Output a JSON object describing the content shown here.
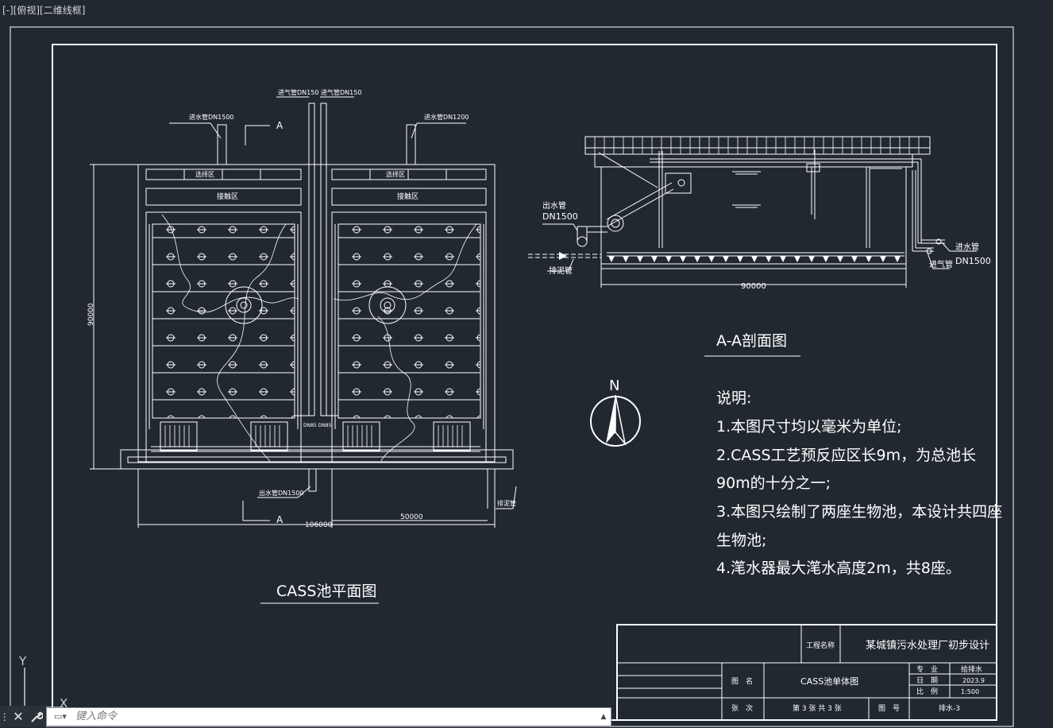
{
  "viewport": {
    "label": "[-][俯视][二维线框]"
  },
  "plan_view": {
    "title": "CASS池平面图",
    "section_marker": "A",
    "pipes": {
      "inlet_left": "进水管DN1500",
      "inlet_right": "进水管DN1200",
      "air_left": "进气管DN150",
      "air_right": "进气管DN150",
      "drain": "排泥管",
      "outlet": "出水管DN1500",
      "small_pipes": "DN85 DN85"
    },
    "zones": {
      "pre_reaction": "选择区",
      "contact": "接触区"
    },
    "dims": {
      "height": "90000",
      "total_width": "106000",
      "half_width": "50000"
    }
  },
  "section_view": {
    "title": "A-A剖面图",
    "outlet_label": "出水管",
    "outlet_dn": "DN1500",
    "drain_label": "排泥管",
    "inlet_label": "进水管",
    "inlet_dn": "DN1500",
    "air_label": "进气管",
    "length": "90000"
  },
  "north": {
    "label": "N"
  },
  "notes": {
    "heading": "说明:",
    "items": [
      "1.本图尺寸均以毫米为单位;",
      "2.CASS工艺预反应区长9m，为总池长",
      "90m的十分之一;",
      "3.本图只绘制了两座生物池，本设计共四座",
      "生物池;",
      "4.滗水器最大滗水高度2m，共8座。"
    ]
  },
  "title_block": {
    "project_label": "工程名称",
    "project_name": "某城镇污水处理厂初步设计",
    "drawing_label": "图　名",
    "drawing_name": "CASS池单体图",
    "specialty_label": "专　业",
    "specialty_value": "给排水",
    "date_label": "日　期",
    "date_value": "2023.9",
    "scale_label": "比　例",
    "scale_value": "1:500",
    "sheet_label": "张　次",
    "sheet_value": "第 3 张  共 3 张",
    "number_label": "图　号",
    "number_value": "排水-3"
  },
  "ucs": {
    "y": "Y",
    "x": "X"
  },
  "command_line": {
    "placeholder": "键入命令"
  },
  "colors": {
    "background": "#212830",
    "lines": "#ffffff"
  }
}
